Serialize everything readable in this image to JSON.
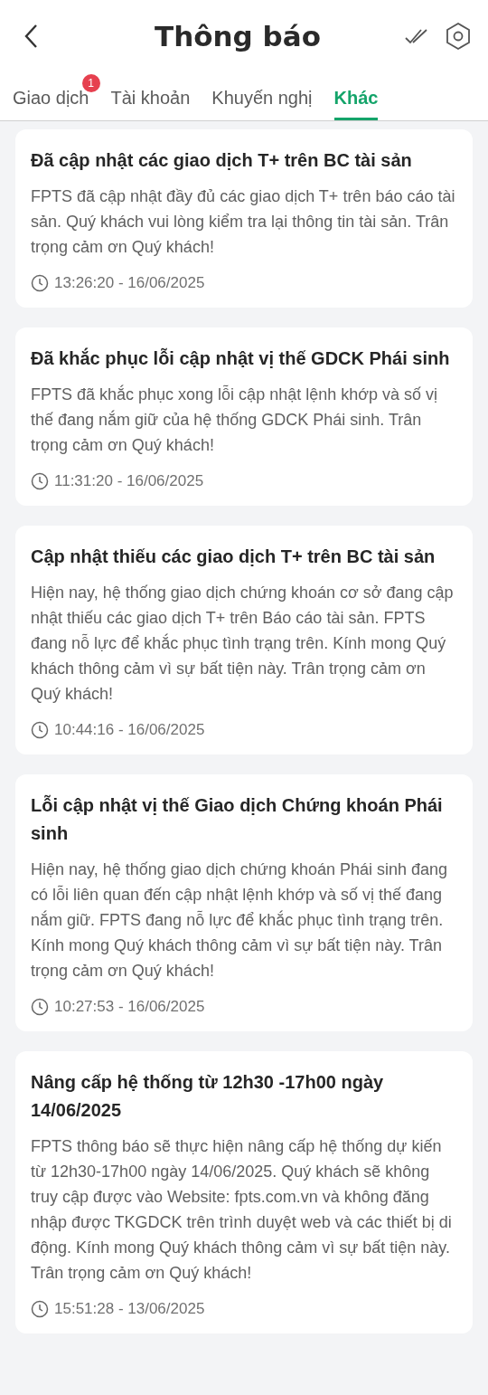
{
  "header": {
    "title": "Thông báo"
  },
  "tabs": [
    {
      "label": "Giao dịch",
      "selected": false,
      "badge": "1"
    },
    {
      "label": "Tài khoản",
      "selected": false
    },
    {
      "label": "Khuyến nghị",
      "selected": false
    },
    {
      "label": "Khác",
      "selected": true
    }
  ],
  "notifications": [
    {
      "title": "Đã cập nhật các giao dịch T+ trên BC tài sản",
      "body": "FPTS đã cập nhật đầy đủ các giao dịch T+ trên báo cáo tài sản. Quý khách vui lòng kiểm tra lại thông tin tài sản. Trân trọng cảm ơn Quý khách!",
      "time": "13:26:20 - 16/06/2025"
    },
    {
      "title": "Đã khắc phục lỗi cập nhật vị thế GDCK Phái sinh",
      "body": "FPTS đã khắc phục xong lỗi cập nhật lệnh khớp và số vị thế đang nắm giữ của hệ thống GDCK Phái sinh. Trân trọng cảm ơn Quý khách!",
      "time": "11:31:20 - 16/06/2025"
    },
    {
      "title": "Cập nhật thiếu các giao dịch T+ trên BC tài sản",
      "body": "Hiện nay, hệ thống giao dịch chứng khoán cơ sở đang cập nhật thiếu các giao dịch T+ trên Báo cáo tài sản. FPTS đang nỗ lực để khắc phục tình trạng trên. Kính mong Quý khách thông cảm vì sự bất tiện này. Trân trọng cảm ơn Quý khách!",
      "time": "10:44:16 - 16/06/2025"
    },
    {
      "title": "Lỗi cập nhật vị thế Giao dịch Chứng khoán Phái sinh",
      "body": "Hiện nay, hệ thống giao dịch chứng khoán Phái sinh đang có lỗi liên quan đến cập nhật lệnh khớp và số vị thế đang nắm giữ. FPTS đang nỗ lực để khắc phục tình trạng trên. Kính mong Quý khách thông cảm vì sự bất tiện này. Trân trọng cảm ơn Quý khách!",
      "time": "10:27:53 - 16/06/2025"
    },
    {
      "title": "Nâng cấp hệ thống từ 12h30 -17h00 ngày 14/06/2025",
      "body": "FPTS thông báo sẽ thực hiện nâng cấp hệ thống dự kiến từ 12h30-17h00 ngày 14/06/2025. Quý khách sẽ không truy cập được vào Website: fpts.com.vn và không đăng nhập được TKGDCK trên trình duyệt web và các thiết bị di động. Kính mong Quý khách thông cảm vì sự bất tiện này. Trân trọng cảm ơn Quý khách!",
      "time": "15:51:28 - 13/06/2025"
    }
  ]
}
